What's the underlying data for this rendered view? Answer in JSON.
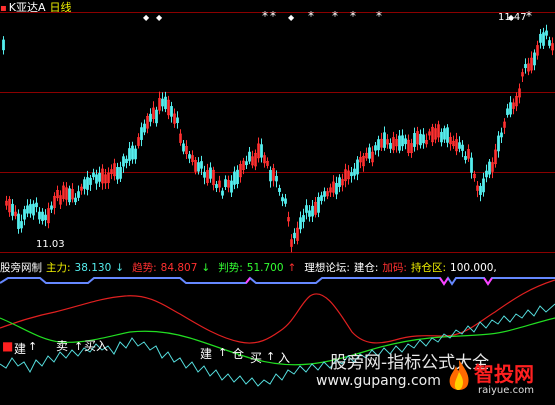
{
  "title": {
    "symbol": "K亚达A",
    "period": "日线"
  },
  "price_pane": {
    "high_label": "11.47",
    "low_label": "11.03",
    "marker_symbol": "*",
    "marker_symbol_alt": "◆",
    "colors": {
      "up": "#ff3030",
      "down": "#5ee",
      "grid": "#8b0000"
    }
  },
  "indicator_row": {
    "name": "股旁网制",
    "main_force_label": "主力:",
    "main_force_value": "38.130",
    "main_force_arrow": "↓",
    "trend_label": "趋势:",
    "trend_value": "84.807",
    "trend_arrow": "↓",
    "judge_label": "判势:",
    "judge_value": "51.700",
    "judge_arrow": "↑",
    "forum_label": "理想论坛:",
    "build_label": "建仓:",
    "add_label": "加码:",
    "hold_label": "持仓区:",
    "hold_value": "100.000,"
  },
  "lower_pane": {
    "signals_left": [
      "建",
      "卖",
      "买",
      "入"
    ],
    "signals_mid": [
      "建",
      "仓",
      "买",
      "入"
    ],
    "arrow": "↑"
  },
  "watermark": {
    "text": "股旁网-指标公式大全",
    "url": "www.gupang.com"
  },
  "logo": {
    "name": "智投网",
    "url": "raiyue.com"
  }
}
